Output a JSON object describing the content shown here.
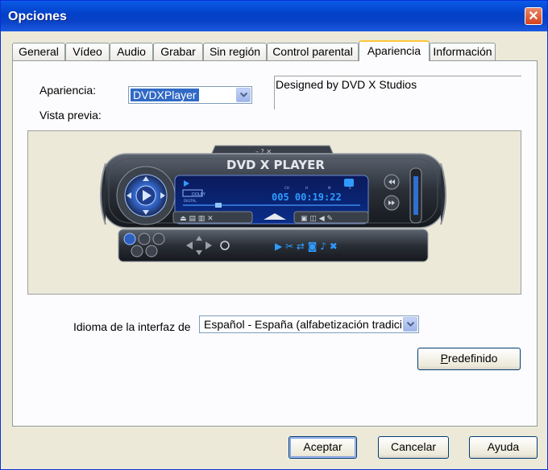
{
  "window": {
    "title": "Opciones",
    "close_symbol": "✕"
  },
  "tabs": [
    {
      "label": "General",
      "active": false
    },
    {
      "label": "Vídeo",
      "active": false
    },
    {
      "label": "Audio",
      "active": false
    },
    {
      "label": "Grabar",
      "active": false
    },
    {
      "label": "Sin región",
      "active": false
    },
    {
      "label": "Control parental",
      "active": false
    },
    {
      "label": "Apariencia",
      "active": true
    },
    {
      "label": "Información",
      "active": false
    }
  ],
  "appearance": {
    "label": "Apariencia:",
    "selected": "DVDXPlayer",
    "description": "Designed by DVD X Studios",
    "preview_label": "Vista previa:"
  },
  "player_preview": {
    "logo": "DVD X PLAYER",
    "counter": "005 00:19:22",
    "dolby": "DOLBY",
    "dolby_sub": "DIGITAL",
    "ch_labels": [
      "CH",
      "H",
      "M",
      "S"
    ]
  },
  "language": {
    "label": "Idioma de la interfaz de",
    "selected": "Español - España (alfabetización tradicional)"
  },
  "buttons": {
    "default": {
      "prefix": "P",
      "rest": "redefinido"
    },
    "ok": "Aceptar",
    "cancel": "Cancelar",
    "help": "Ayuda"
  },
  "colors": {
    "titlebar": "#0340c8",
    "tab_accent": "#ffc73c",
    "selection": "#316ac5",
    "lcd": "#2f9bff"
  }
}
